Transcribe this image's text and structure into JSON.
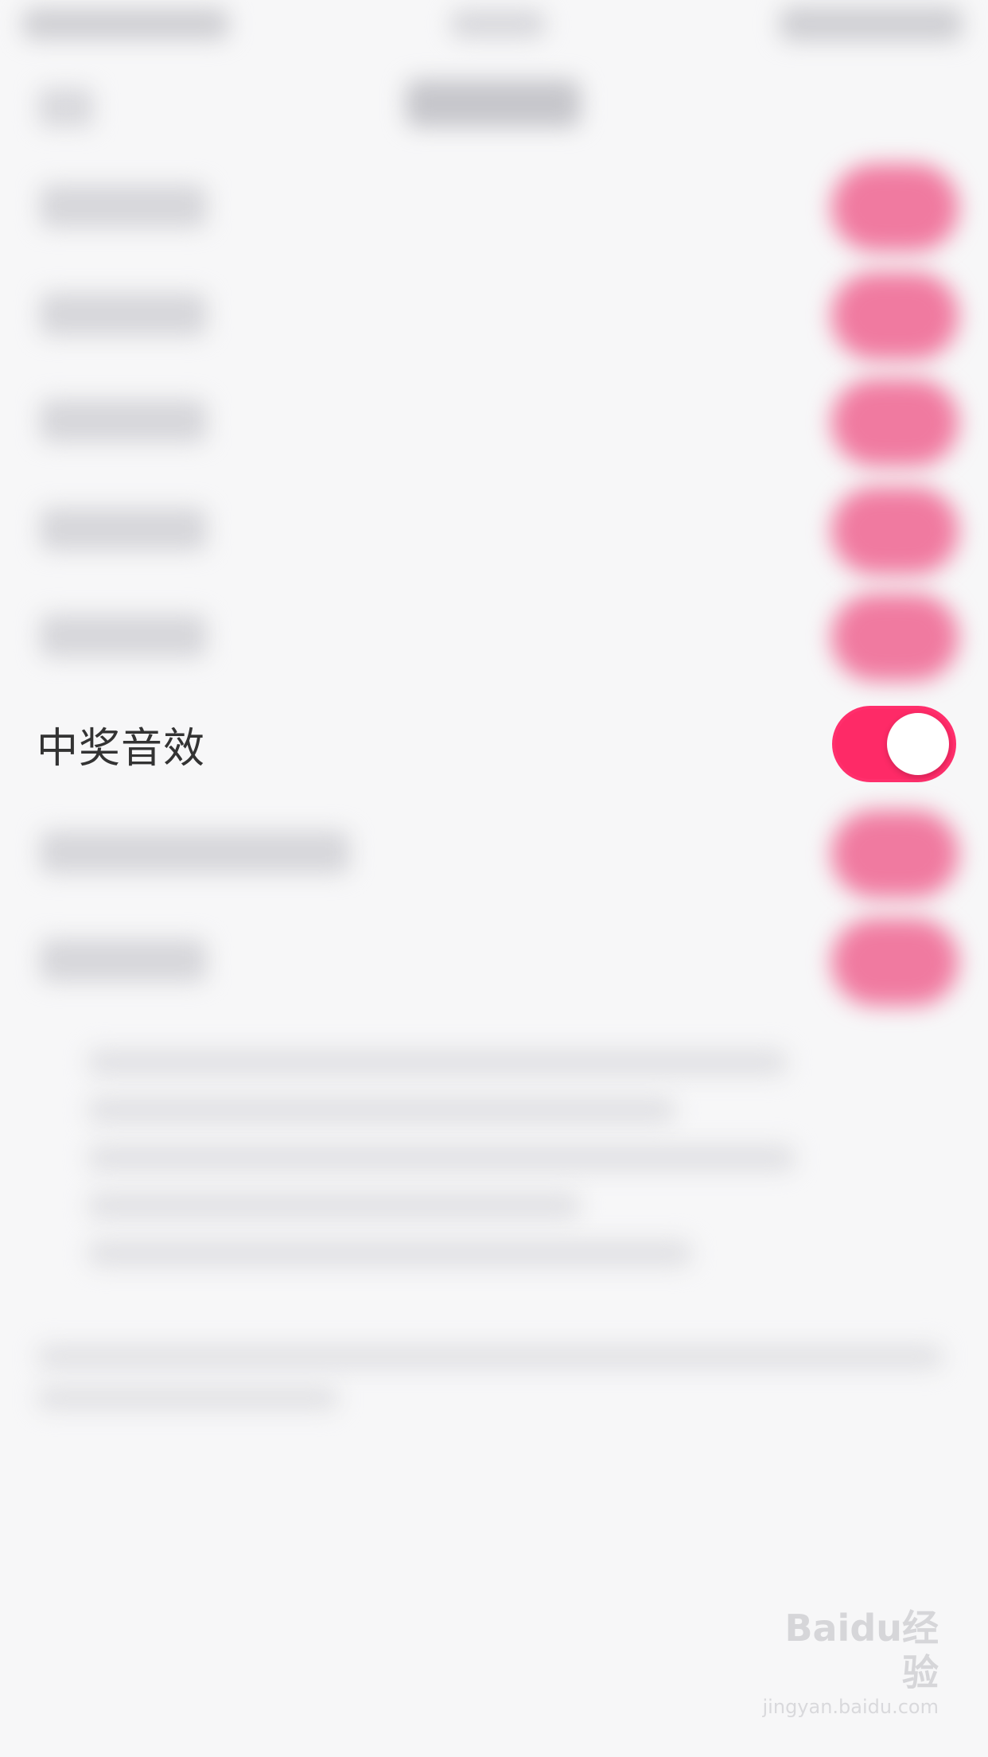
{
  "settings": {
    "focused_row": {
      "label": "中奖音效",
      "toggle_on": true
    }
  },
  "colors": {
    "background": "#f7f7f8",
    "toggle_on": "#fe2a67",
    "toggle_knob": "#ffffff",
    "label_text": "#333333"
  },
  "watermark": {
    "logo": "Baidu经验",
    "sub": "jingyan.baidu.com"
  }
}
